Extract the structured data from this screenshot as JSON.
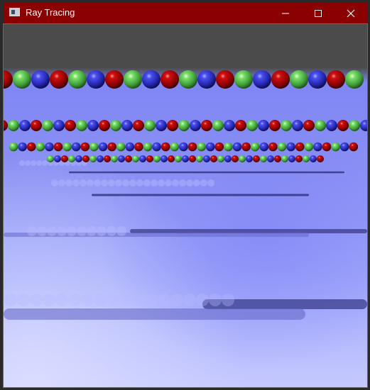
{
  "window": {
    "title": "Ray Tracing"
  },
  "titlebar_icons": {
    "app": "application-icon",
    "minimize": "minimize-icon",
    "maximize": "maximize-icon",
    "close": "close-icon"
  },
  "colors": {
    "titlebar": "#8b0000",
    "sky": "#4b4b4b",
    "floor": "#8f95f6",
    "red_sphere": "#b00000",
    "green_sphere": "#66d35a",
    "blue_sphere": "#3b3fe0",
    "shadow": "#3a3a8a"
  }
}
